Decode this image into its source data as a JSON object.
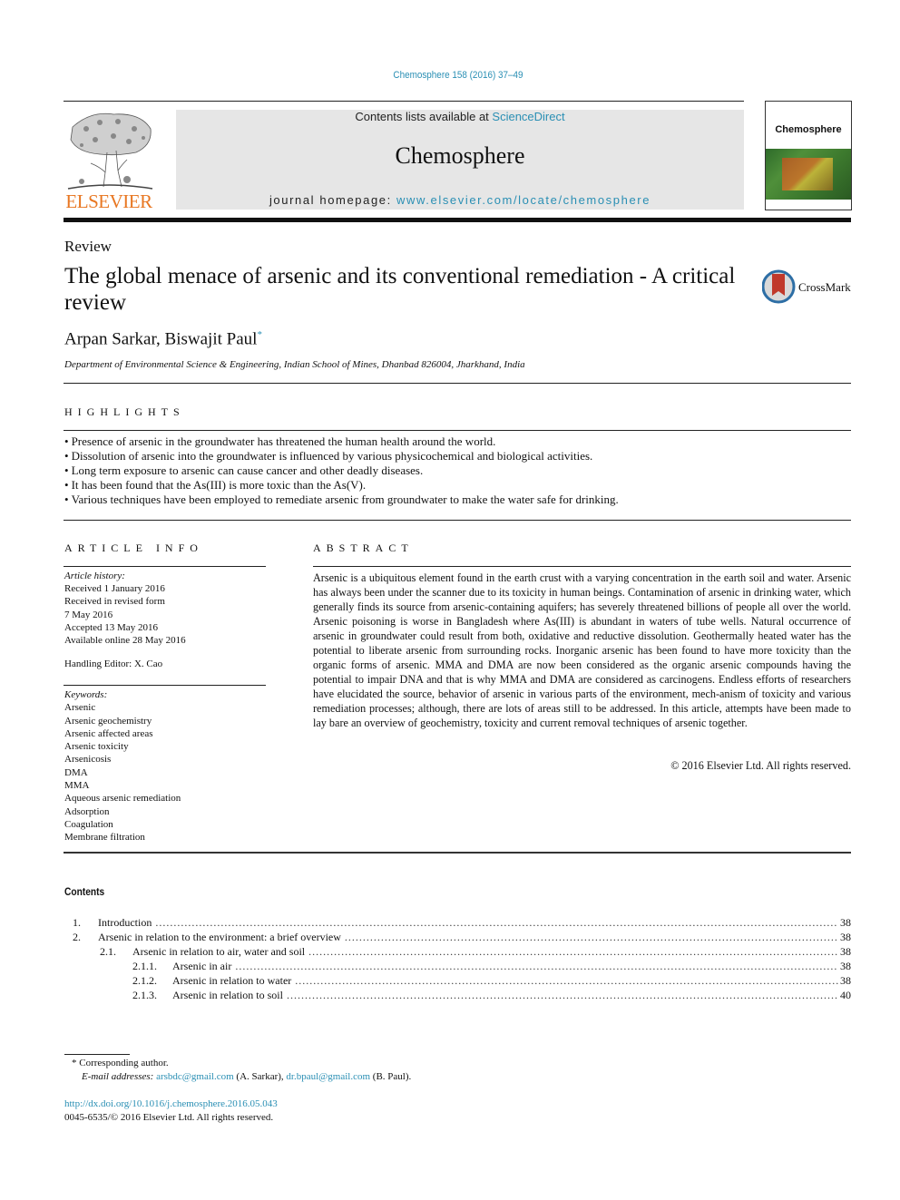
{
  "header": {
    "citation": "Chemosphere 158 (2016) 37–49",
    "publisher_name": "ELSEVIER",
    "contents_prefix": "Contents lists available at ",
    "contents_link": "ScienceDirect",
    "journal_name": "Chemosphere",
    "homepage_prefix": "journal homepage: ",
    "homepage_link": "www.elsevier.com/locate/chemosphere",
    "cover_title": "Chemosphere"
  },
  "article": {
    "type": "Review",
    "title": "The global menace of arsenic and its conventional remediation - A critical review",
    "crossmark_label": "CrossMark",
    "authors": "Arpan Sarkar, Biswajit Paul",
    "corresponding_mark": "*",
    "affiliation": "Department of Environmental Science & Engineering, Indian School of Mines, Dhanbad 826004, Jharkhand, India"
  },
  "highlights": {
    "heading": "HIGHLIGHTS",
    "items": [
      "Presence of arsenic in the groundwater has threatened the human health around the world.",
      "Dissolution of arsenic into the groundwater is influenced by various physicochemical and biological activities.",
      "Long term exposure to arsenic can cause cancer and other deadly diseases.",
      "It has been found that the As(III) is more toxic than the As(V).",
      "Various techniques have been employed to remediate arsenic from groundwater to make the water safe for drinking."
    ]
  },
  "article_info": {
    "heading": "ARTICLE INFO",
    "history_label": "Article history:",
    "history": [
      "Received 1 January 2016",
      "Received in revised form",
      "7 May 2016",
      "Accepted 13 May 2016",
      "Available online 28 May 2016"
    ],
    "handling_editor": "Handling Editor: X. Cao",
    "keywords_label": "Keywords:",
    "keywords": [
      "Arsenic",
      "Arsenic geochemistry",
      "Arsenic affected areas",
      "Arsenic toxicity",
      "Arsenicosis",
      "DMA",
      "MMA",
      "Aqueous arsenic remediation",
      "Adsorption",
      "Coagulation",
      "Membrane filtration"
    ]
  },
  "abstract": {
    "heading": "ABSTRACT",
    "text": "Arsenic is a ubiquitous element found in the earth crust with a varying concentration in the earth soil and water. Arsenic has always been under the scanner due to its toxicity in human beings. Contamination of arsenic in drinking water, which generally finds its source from arsenic-containing aquifers; has severely threatened billions of people all over the world. Arsenic poisoning is worse in Bangladesh where As(III) is abundant in waters of tube wells. Natural occurrence of arsenic in groundwater could result from both, oxidative and reductive dissolution. Geothermally heated water has the potential to liberate arsenic from surrounding rocks. Inorganic arsenic has been found to have more toxicity than the organic forms of arsenic. MMA and DMA are now been considered as the organic arsenic compounds having the potential to impair DNA and that is why MMA and DMA are considered as carcinogens. Endless efforts of researchers have elucidated the source, behavior of arsenic in various parts of the environment, mech-anism of toxicity and various remediation processes; although, there are lots of areas still to be addressed. In this article, attempts have been made to lay bare an overview of geochemistry, toxicity and current removal techniques of arsenic together.",
    "copyright": "© 2016 Elsevier Ltd. All rights reserved."
  },
  "contents": {
    "heading": "Contents",
    "entries": [
      {
        "num": "1.",
        "label": "Introduction",
        "page": "38",
        "level": 0
      },
      {
        "num": "2.",
        "label": "Arsenic in relation to the environment: a brief overview",
        "page": "38",
        "level": 0
      },
      {
        "num": "2.1.",
        "label": "Arsenic in relation to air, water and soil",
        "page": "38",
        "level": 1
      },
      {
        "num": "2.1.1.",
        "label": "Arsenic in air",
        "page": "38",
        "level": 2
      },
      {
        "num": "2.1.2.",
        "label": "Arsenic in relation to water",
        "page": "38",
        "level": 2
      },
      {
        "num": "2.1.3.",
        "label": "Arsenic in relation to soil",
        "page": "40",
        "level": 2
      }
    ]
  },
  "footnotes": {
    "corresponding": "*  Corresponding author.",
    "email_label": "E-mail addresses:",
    "email1": "arsbdc@gmail.com",
    "email1_owner": " (A. Sarkar), ",
    "email2": "dr.bpaul@gmail.com",
    "email2_owner": " (B. Paul).",
    "doi": "http://dx.doi.org/10.1016/j.chemosphere.2016.05.043",
    "issn": "0045-6535/© 2016 Elsevier Ltd. All rights reserved."
  }
}
